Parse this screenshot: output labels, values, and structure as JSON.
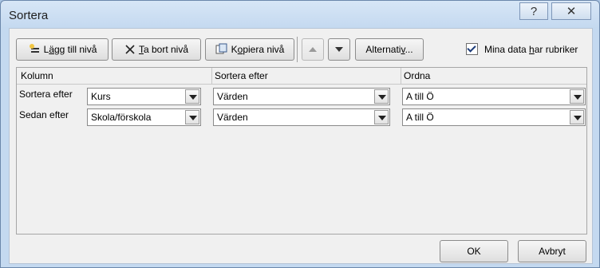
{
  "dialog": {
    "title": "Sortera",
    "help_symbol": "?",
    "close_symbol": "✕"
  },
  "toolbar": {
    "add_level_prefix": "L",
    "add_level_underlined": "ä",
    "add_level_suffix": "gg till nivå",
    "delete_level_underlined": "T",
    "delete_level_suffix": "a bort nivå",
    "copy_level_prefix": "K",
    "copy_level_underlined": "o",
    "copy_level_suffix": "piera nivå",
    "options_prefix": "Alternati",
    "options_underlined": "v",
    "options_suffix": "...",
    "has_headers_prefix": "Mina data ",
    "has_headers_underlined": "h",
    "has_headers_suffix": "ar rubriker",
    "has_headers_checked": true
  },
  "grid": {
    "col_column": "Kolumn",
    "col_sort_on": "Sortera efter",
    "col_order": "Ordna",
    "rows": [
      {
        "label": "Sortera efter",
        "column": "Kurs",
        "sort_on": "Värden",
        "order": "A till Ö"
      },
      {
        "label": "Sedan efter",
        "column": "Skola/förskola",
        "sort_on": "Värden",
        "order": "A till Ö"
      }
    ]
  },
  "footer": {
    "ok": "OK",
    "cancel": "Avbryt"
  }
}
